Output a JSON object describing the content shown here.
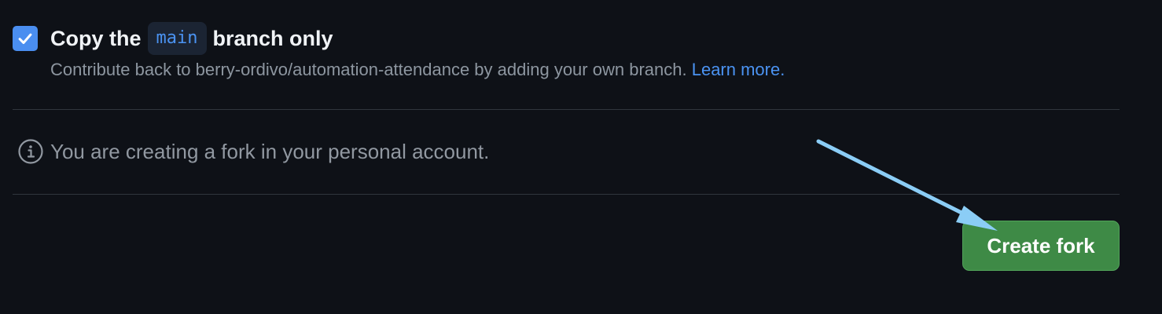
{
  "copy_branch": {
    "checked": true,
    "label_before": "Copy the",
    "branch_name": "main",
    "label_after": "branch only",
    "description": "Contribute back to berry-ordivo/automation-attendance by adding your own branch.",
    "learn_more": "Learn more."
  },
  "info": {
    "icon": "info-icon",
    "message": "You are creating a fork in your personal account."
  },
  "actions": {
    "create_fork_label": "Create fork"
  },
  "annotation": {
    "icon": "arrow-annotation-icon",
    "color": "#8bcdf6"
  },
  "colors": {
    "background": "#0e1117",
    "checkbox": "#4a8ef0",
    "link": "#4b93f2",
    "button": "#3e8a46"
  }
}
